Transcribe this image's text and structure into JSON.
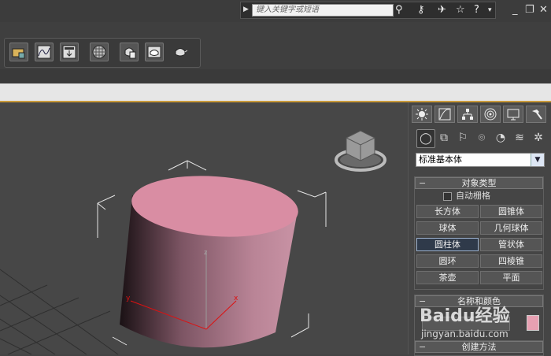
{
  "search": {
    "placeholder": "键入关键字或短语"
  },
  "toolbar": {
    "buttons": [
      "scene-explorer-icon",
      "curve-editor-icon",
      "render-setup-icon",
      "material-editor-icon",
      "render-frame-icon",
      "render-icon",
      "teapot-icon"
    ]
  },
  "command_panel": {
    "dropdown_value": "标准基本体",
    "object_type": {
      "title": "对象类型",
      "autogrid_label": "自动栅格",
      "buttons": [
        "长方体",
        "圆锥体",
        "球体",
        "几何球体",
        "圆柱体",
        "管状体",
        "圆环",
        "四棱锥",
        "茶壶",
        "平面"
      ],
      "active_button": "圆柱体"
    },
    "name_color": {
      "title": "名称和颜色",
      "color": "#e7a0b2"
    },
    "creation_method": {
      "title": "创建方法"
    }
  },
  "viewport": {
    "object_color": "#c98a9e",
    "top_color": "#d9869f"
  },
  "watermark": {
    "logo": "Baidu经验",
    "url": "jingyan.baidu.com"
  }
}
